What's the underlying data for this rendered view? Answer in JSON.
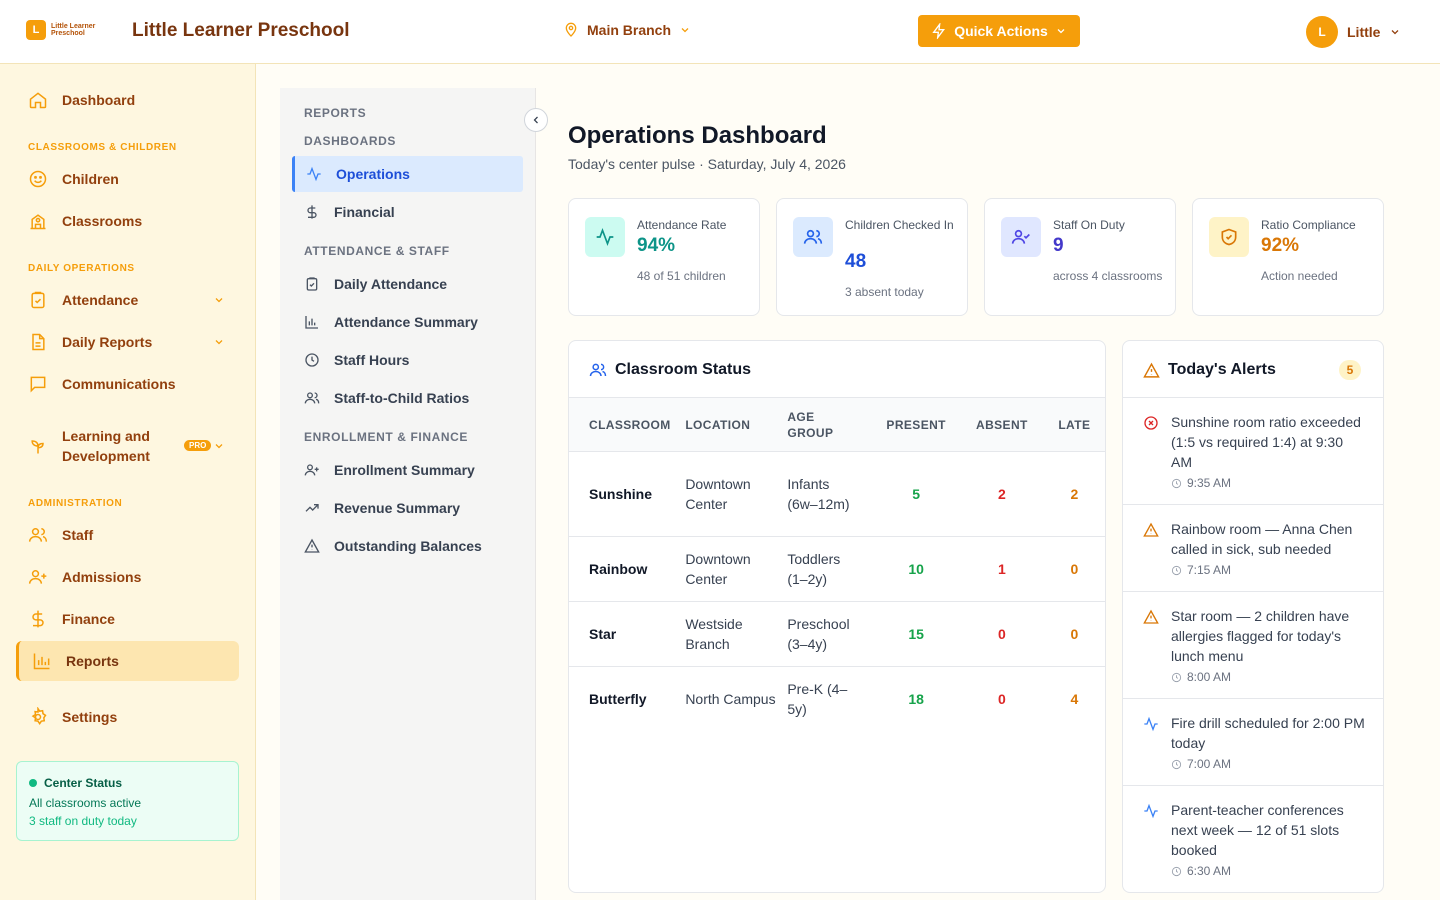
{
  "header": {
    "logo_initial": "L",
    "logo_text": "Little Learner Preschool",
    "title": "Little Learner Preschool",
    "branch": "Main Branch",
    "quick_actions": "Quick Actions",
    "user_initial": "L",
    "user_name": "Little"
  },
  "sidebar": {
    "dashboard": "Dashboard",
    "section_classrooms": "CLASSROOMS & CHILDREN",
    "children": "Children",
    "classrooms": "Classrooms",
    "section_daily": "DAILY OPERATIONS",
    "attendance": "Attendance",
    "daily_reports": "Daily Reports",
    "communications": "Communications",
    "learning": "Learning and Development",
    "pro_badge": "PRO",
    "section_admin": "ADMINISTRATION",
    "staff": "Staff",
    "admissions": "Admissions",
    "finance": "Finance",
    "reports": "Reports",
    "settings": "Settings",
    "center_status": {
      "title": "Center Status",
      "line1": "All classrooms active",
      "line2": "3 staff on duty today"
    }
  },
  "reports_nav": {
    "heading": "REPORTS",
    "section_dashboards": "DASHBOARDS",
    "operations": "Operations",
    "financial": "Financial",
    "section_attendance": "ATTENDANCE & STAFF",
    "daily_attendance": "Daily Attendance",
    "attendance_summary": "Attendance Summary",
    "staff_hours": "Staff Hours",
    "ratios": "Staff-to-Child Ratios",
    "section_enrollment": "ENROLLMENT & FINANCE",
    "enrollment_summary": "Enrollment Summary",
    "revenue_summary": "Revenue Summary",
    "outstanding": "Outstanding Balances"
  },
  "main": {
    "title": "Operations Dashboard",
    "subtitle": "Today's center pulse · Saturday, July 4, 2026",
    "stats": [
      {
        "label": "Attendance Rate",
        "value": "94%",
        "note": "48 of 51 children"
      },
      {
        "label": "Children Checked In",
        "value": "48",
        "note": "3 absent today"
      },
      {
        "label": "Staff On Duty",
        "value": "9",
        "note": "across 4 classrooms"
      },
      {
        "label": "Ratio Compliance",
        "value": "92%",
        "note": "Action needed"
      }
    ],
    "classroom_status": {
      "title": "Classroom Status",
      "columns": [
        "CLASSROOM",
        "LOCATION",
        "AGE GROUP",
        "PRESENT",
        "ABSENT",
        "LATE"
      ],
      "rows": [
        {
          "name": "Sunshine",
          "location": "Downtown Center",
          "age": "Infants (6w–12m)",
          "present": "5",
          "absent": "2",
          "late": "2"
        },
        {
          "name": "Rainbow",
          "location": "Downtown Center",
          "age": "Toddlers (1–2y)",
          "present": "10",
          "absent": "1",
          "late": "0"
        },
        {
          "name": "Star",
          "location": "Westside Branch",
          "age": "Preschool (3–4y)",
          "present": "15",
          "absent": "0",
          "late": "0"
        },
        {
          "name": "Butterfly",
          "location": "North Campus",
          "age": "Pre-K (4–5y)",
          "present": "18",
          "absent": "0",
          "late": "4"
        }
      ]
    },
    "alerts": {
      "title": "Today's Alerts",
      "count": "5",
      "items": [
        {
          "icon": "x-circle-icon",
          "text": "Sunshine room ratio exceeded (1:5 vs required 1:4) at 9:30 AM",
          "time": "9:35 AM"
        },
        {
          "icon": "warning-icon",
          "text": "Rainbow room — Anna Chen called in sick, sub needed",
          "time": "7:15 AM"
        },
        {
          "icon": "warning-icon",
          "text": "Star room — 2 children have allergies flagged for today's lunch menu",
          "time": "8:00 AM"
        },
        {
          "icon": "activity-icon",
          "text": "Fire drill scheduled for 2:00 PM today",
          "time": "7:00 AM"
        },
        {
          "icon": "activity-icon",
          "text": "Parent-teacher conferences next week — 12 of 51 slots booked",
          "time": "6:30 AM"
        }
      ]
    }
  },
  "colors": {
    "accent": "#f59e0b",
    "active_blue": "#3b82f6",
    "present": "#16a34a",
    "absent": "#dc2626",
    "late": "#d97706"
  }
}
